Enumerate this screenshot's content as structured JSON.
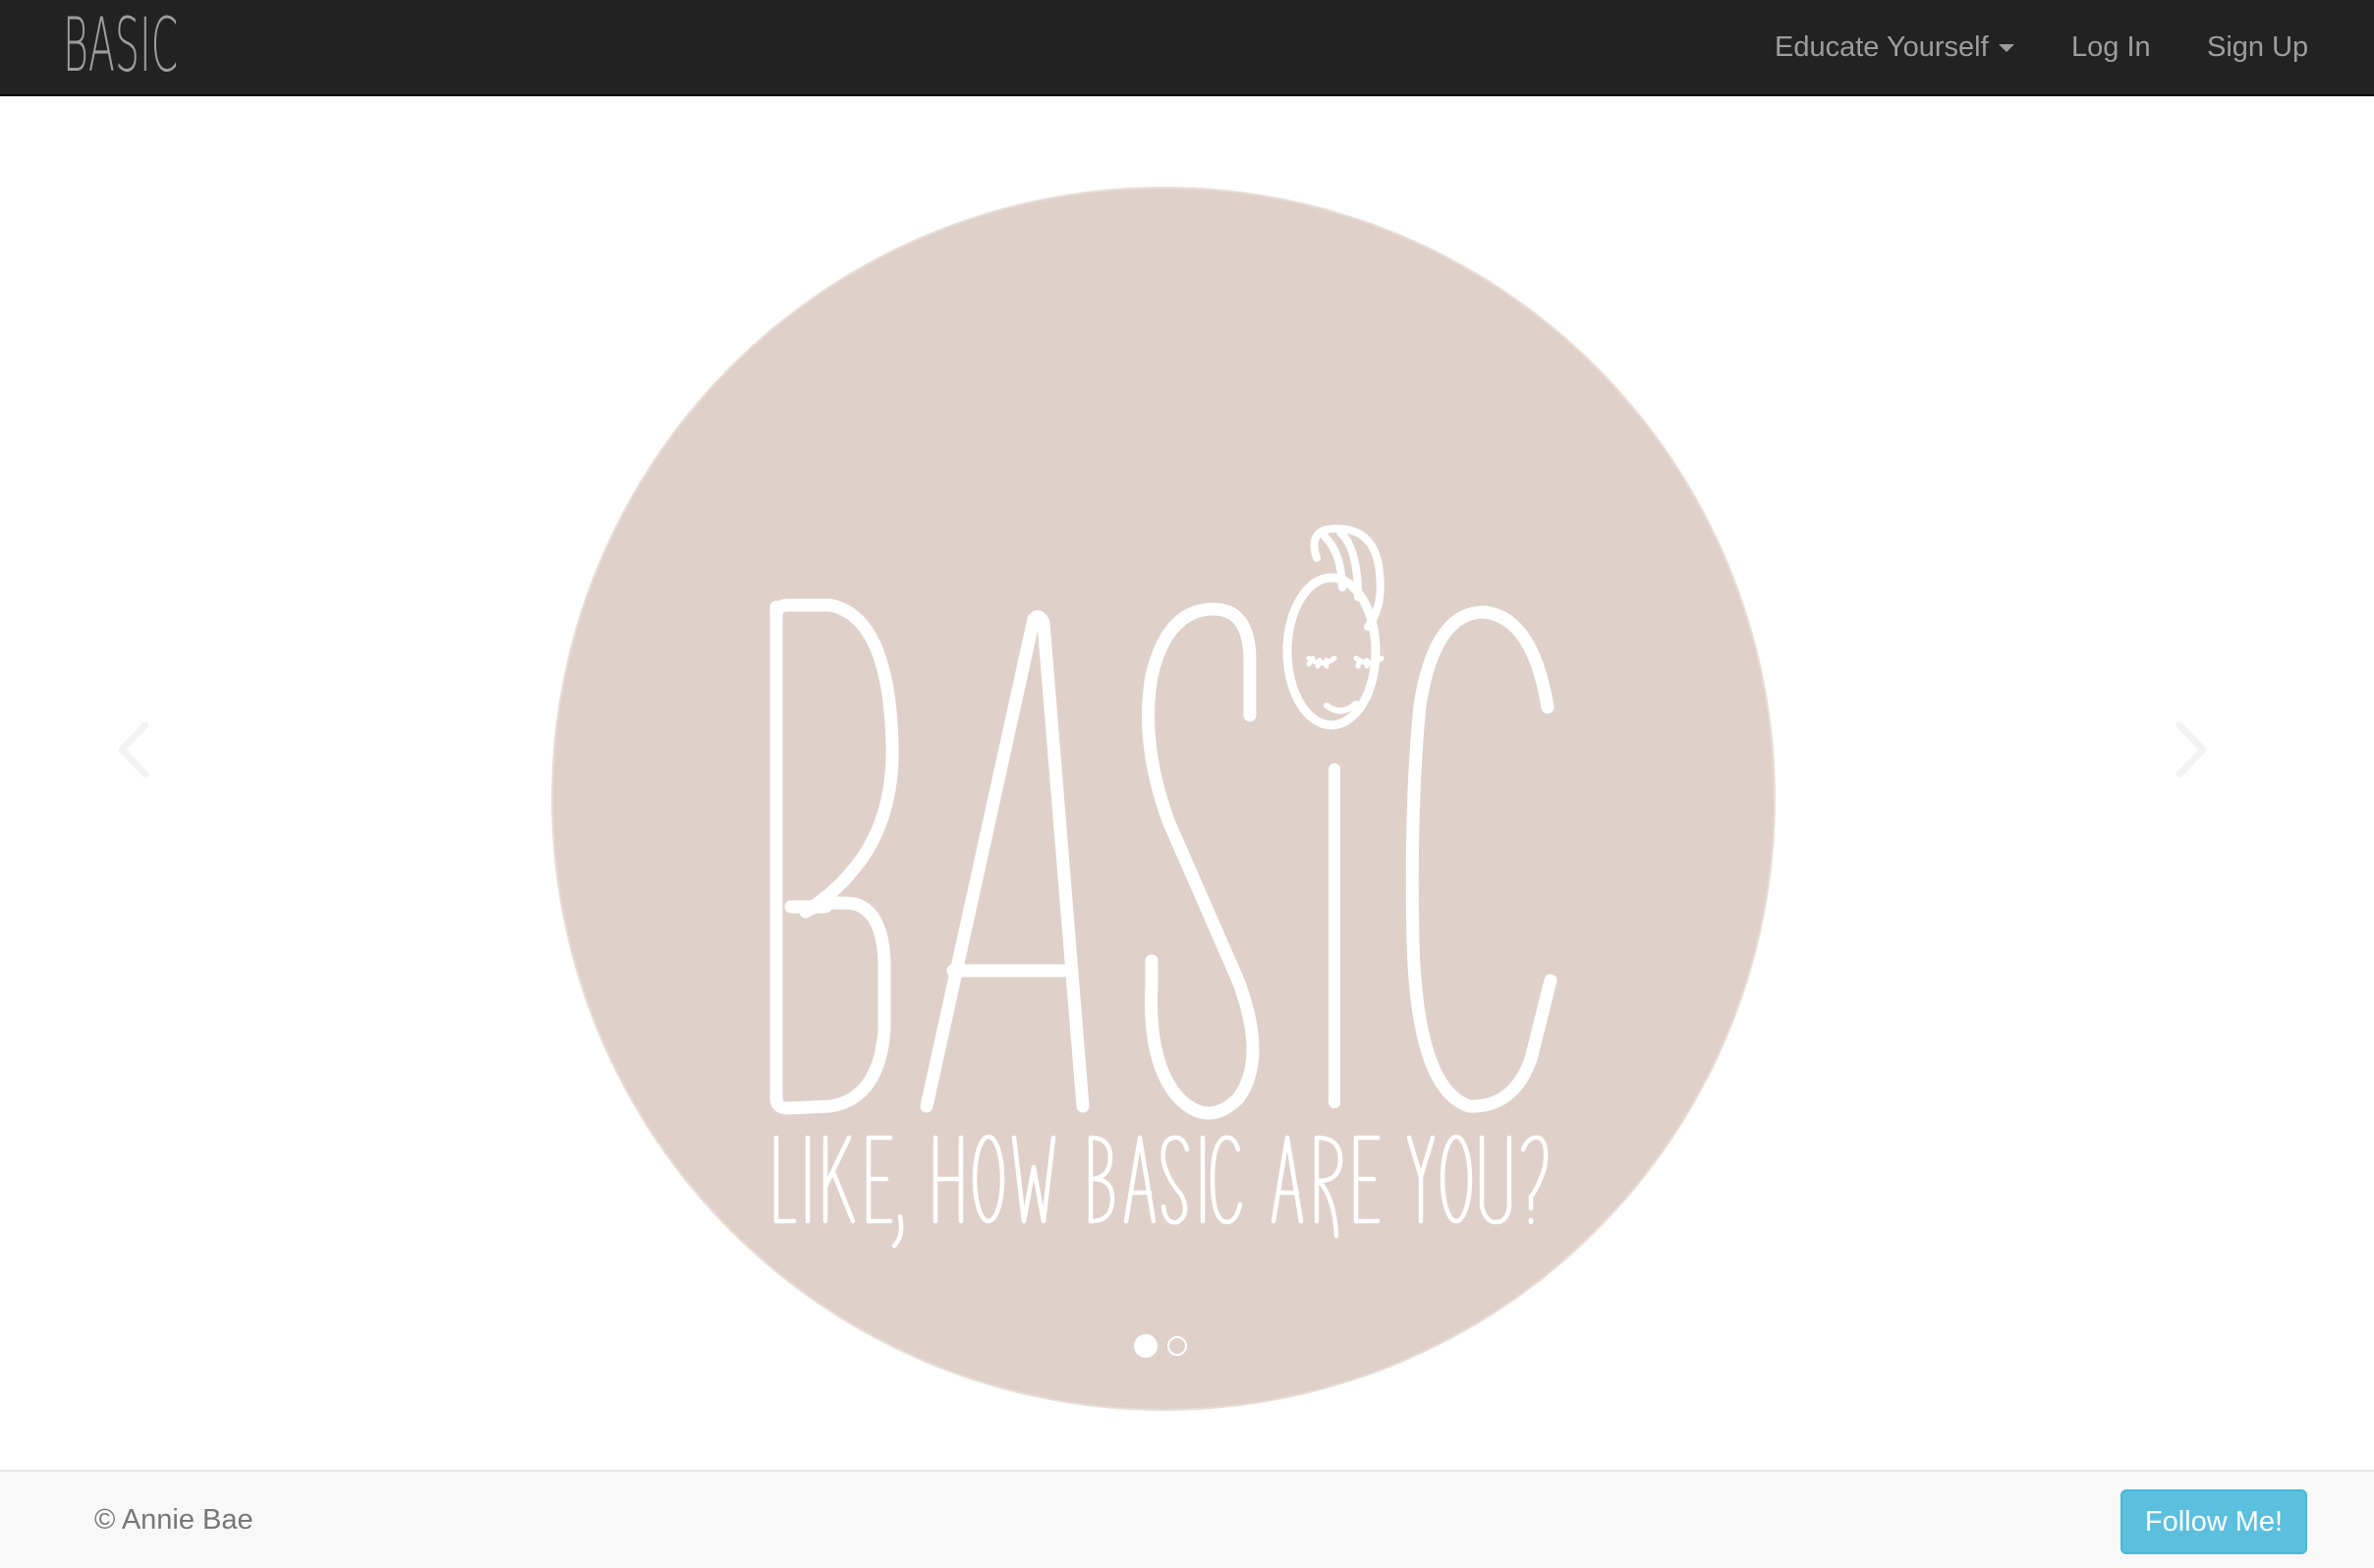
{
  "navbar": {
    "brand": "BASIC",
    "links": {
      "educate": "Educate Yourself",
      "login": "Log In",
      "signup": "Sign Up"
    }
  },
  "carousel": {
    "slide": {
      "logo_text": "BASIC",
      "tagline": "LIKE, HOW BASIC ARE YOU?"
    },
    "indicator_count": 2,
    "active_index": 0,
    "prev_icon": "chevron-left-icon",
    "next_icon": "chevron-right-icon"
  },
  "footer": {
    "copyright": "© Annie Bae",
    "follow_label": "Follow Me!"
  },
  "colors": {
    "navbar_bg": "#222222",
    "nav_text": "#9d9d9d",
    "circle": "#dfd1c9",
    "footer_bg": "#f8f8f8",
    "button_info": "#5bc0de"
  }
}
